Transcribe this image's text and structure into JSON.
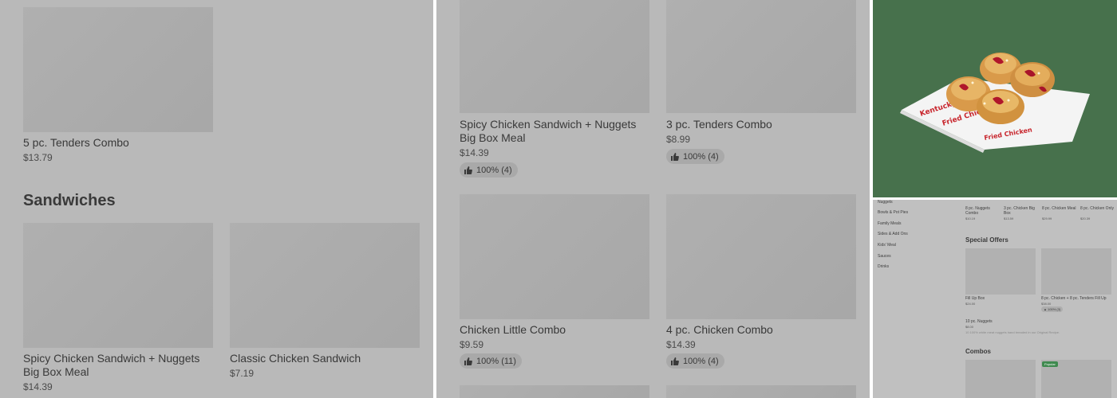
{
  "panel1": {
    "item_top": {
      "name": "5 pc. Tenders Combo",
      "price": "$13.79"
    },
    "section_title": "Sandwiches",
    "item_a": {
      "name": "Spicy Chicken Sandwich + Nuggets Big Box Meal",
      "price": "$14.39"
    },
    "item_b": {
      "name": "Classic Chicken Sandwich",
      "price": "$7.19"
    }
  },
  "panel2": {
    "items": [
      {
        "name": "Spicy Chicken Sandwich + Nuggets Big Box Meal",
        "price": "$14.39",
        "rating": "100% (4)"
      },
      {
        "name": "3 pc. Tenders Combo",
        "price": "$8.99",
        "rating": "100% (4)"
      },
      {
        "name": "Chicken Little Combo",
        "price": "$9.59",
        "rating": "100% (11)"
      },
      {
        "name": "4 pc. Chicken Combo",
        "price": "$14.39",
        "rating": "100% (4)"
      }
    ]
  },
  "panel3": {
    "wrapper_text_1": "Kentucky",
    "wrapper_text_2": "Fried Chicken"
  },
  "panel4": {
    "sidebar": [
      "Nuggets",
      "Bowls & Pot Pies",
      "Family Meals",
      "Sides & Add Ons",
      "Kids' Meal",
      "Sauces",
      "Drinks"
    ],
    "top_items": [
      {
        "name": "8 pc. Nuggets Combo",
        "price": "$10.19"
      },
      {
        "name": "3 pc. Chicken Big Box",
        "price": "$13.59"
      },
      {
        "name": "8 pc. Chicken Meal",
        "price": "$29.99"
      },
      {
        "name": "8 pc. Chicken Only",
        "price": "$20.39"
      }
    ],
    "special_offers_title": "Special Offers",
    "offers": [
      {
        "name": "Fill Up Box",
        "price": "$24.00"
      },
      {
        "name": "8 pc. Chicken + 8 pc. Tenders Fill Up",
        "price": "$38.00",
        "rating": "100% (3)"
      }
    ],
    "nuggets_item": {
      "name": "10 pc. Nuggets",
      "price": "$8.00",
      "desc": "10 100% white meat nuggets hand breaded in our Original Recipe."
    },
    "combos_title": "Combos",
    "popular_badge": "Popular"
  },
  "colors": {
    "overlay_grey": "#b9b9b9",
    "image_bg_green": "#47714c",
    "badge_green": "#3f8a4f"
  },
  "icons": {
    "rating": "thumbs-up-icon"
  }
}
